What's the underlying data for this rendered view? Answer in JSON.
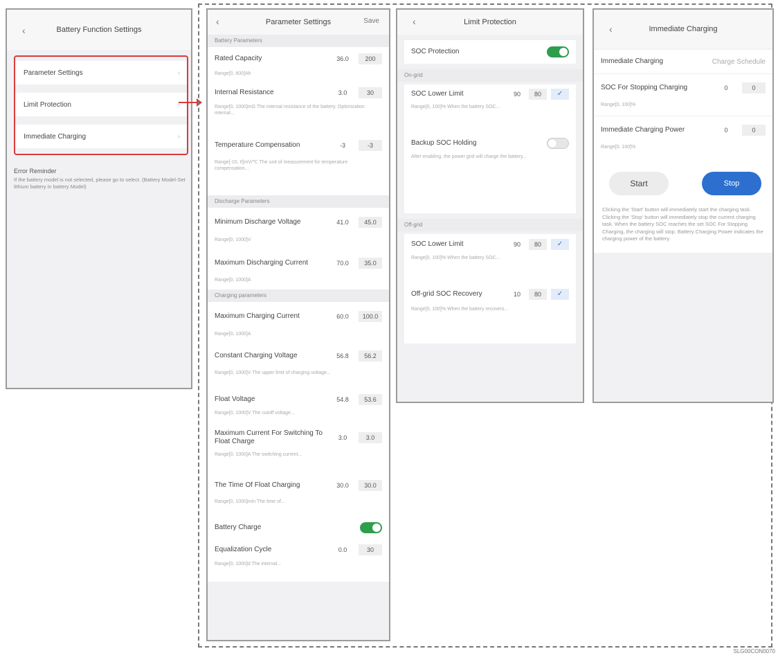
{
  "screen1": {
    "title": "Battery Function Settings",
    "menu": [
      {
        "label": "Parameter Settings"
      },
      {
        "label": "Limit Protection"
      },
      {
        "label": "Immediate Charging"
      }
    ],
    "reminder_title": "Error Reminder",
    "reminder_text": "If the battery model is not selected, please go to select. (Battery Model-Set lithium battery in battery Model)"
  },
  "screen2": {
    "title": "Parameter Settings",
    "save": "Save",
    "sec_battery": "Battery Parameters",
    "sec_discharge": "Discharge Parameters",
    "sec_charge": "Charging parameters",
    "rows": {
      "rated_capacity": {
        "label": "Rated Capacity",
        "v1": "36.0",
        "v2": "200",
        "hint": "Range[0, 800]Ah"
      },
      "internal_resistance": {
        "label": "Internal Resistance",
        "v1": "3.0",
        "v2": "30",
        "hint": "Range[0, 1000]mΩ The internal resistance of the battery. Optimization internal..."
      },
      "temp_comp": {
        "label": "Temperature Compensation",
        "v1": "-3",
        "v2": "-3",
        "hint": "Range[-10, 0]mV/℃ The unit of measurement for temperature compensation..."
      },
      "min_discharge_v": {
        "label": "Minimum Discharge Voltage",
        "v1": "41.0",
        "v2": "45.0",
        "hint": "Range[0, 1000]V"
      },
      "max_discharge_c": {
        "label": "Maximum Discharging Current",
        "v1": "70.0",
        "v2": "35.0",
        "hint": "Range[0, 1000]A"
      },
      "max_charge_c": {
        "label": "Maximum Charging Current",
        "v1": "60.0",
        "v2": "100.0",
        "hint": "Range[0, 1000]A"
      },
      "const_charge_v": {
        "label": "Constant Charging Voltage",
        "v1": "56.8",
        "v2": "56.2",
        "hint": "Range[0, 1000]V The upper limit of charging voltage..."
      },
      "float_v": {
        "label": "Float Voltage",
        "v1": "54.8",
        "v2": "53.6",
        "hint": "Range[0, 1000]V The cutoff voltage..."
      },
      "max_current_float": {
        "label": "Maximum Current For Switching To Float Charge",
        "v1": "3.0",
        "v2": "3.0",
        "hint": "Range[0, 1000]A The switching current..."
      },
      "time_float": {
        "label": "The Time Of Float Charging",
        "v1": "30.0",
        "v2": "30.0",
        "hint": "Range[0, 1000]min The time of..."
      },
      "battery_charge": {
        "label": "Battery Charge"
      },
      "equalization_cycle": {
        "label": "Equalization Cycle",
        "v1": "0.0",
        "v2": "30",
        "hint": "Range[0, 1000]d The interval..."
      }
    }
  },
  "screen3": {
    "title": "Limit Protection",
    "soc_protection": "SOC Protection",
    "sec_ongrid": "On-grid",
    "sec_offgrid": "Off-grid",
    "ongrid_soc": {
      "label": "SOC Lower Limit",
      "v1": "90",
      "v2": "80",
      "check": "✓",
      "hint": "Range[0, 100]% When the battery SOC..."
    },
    "backup_soc": {
      "label": "Backup SOC Holding",
      "hint": "After enabling, the power grid will charge the battery..."
    },
    "offgrid_soc": {
      "label": "SOC Lower Limit",
      "v1": "90",
      "v2": "80",
      "check": "✓",
      "hint": "Range[0, 100]% When the battery SOC..."
    },
    "offgrid_recovery": {
      "label": "Off-grid SOC Recovery",
      "v1": "10",
      "v2": "80",
      "check": "✓",
      "hint": "Range[0, 100]% When the battery recovers..."
    }
  },
  "screen4": {
    "title": "Immediate Charging",
    "tab1": "Immediate Charging",
    "tab2": "Charge Schedule",
    "soc_stop": {
      "label": "SOC For Stopping Charging",
      "v1": "0",
      "v2": "0",
      "hint": "Range[0, 100]%"
    },
    "charge_power": {
      "label": "Immediate Charging Power",
      "v1": "0",
      "v2": "0",
      "hint": "Range[0, 100]%"
    },
    "start": "Start",
    "stop": "Stop",
    "note": "Clicking the 'Start' button will immediately start the charging task. Clicking the 'Stop' button will immediately stop the current charging task. When the battery SOC reaches the set SOC For Stopping Charging, the charging will stop. Battery Charging Power indicates the charging power of the battery."
  },
  "footer_code": "SLG00CON0070"
}
